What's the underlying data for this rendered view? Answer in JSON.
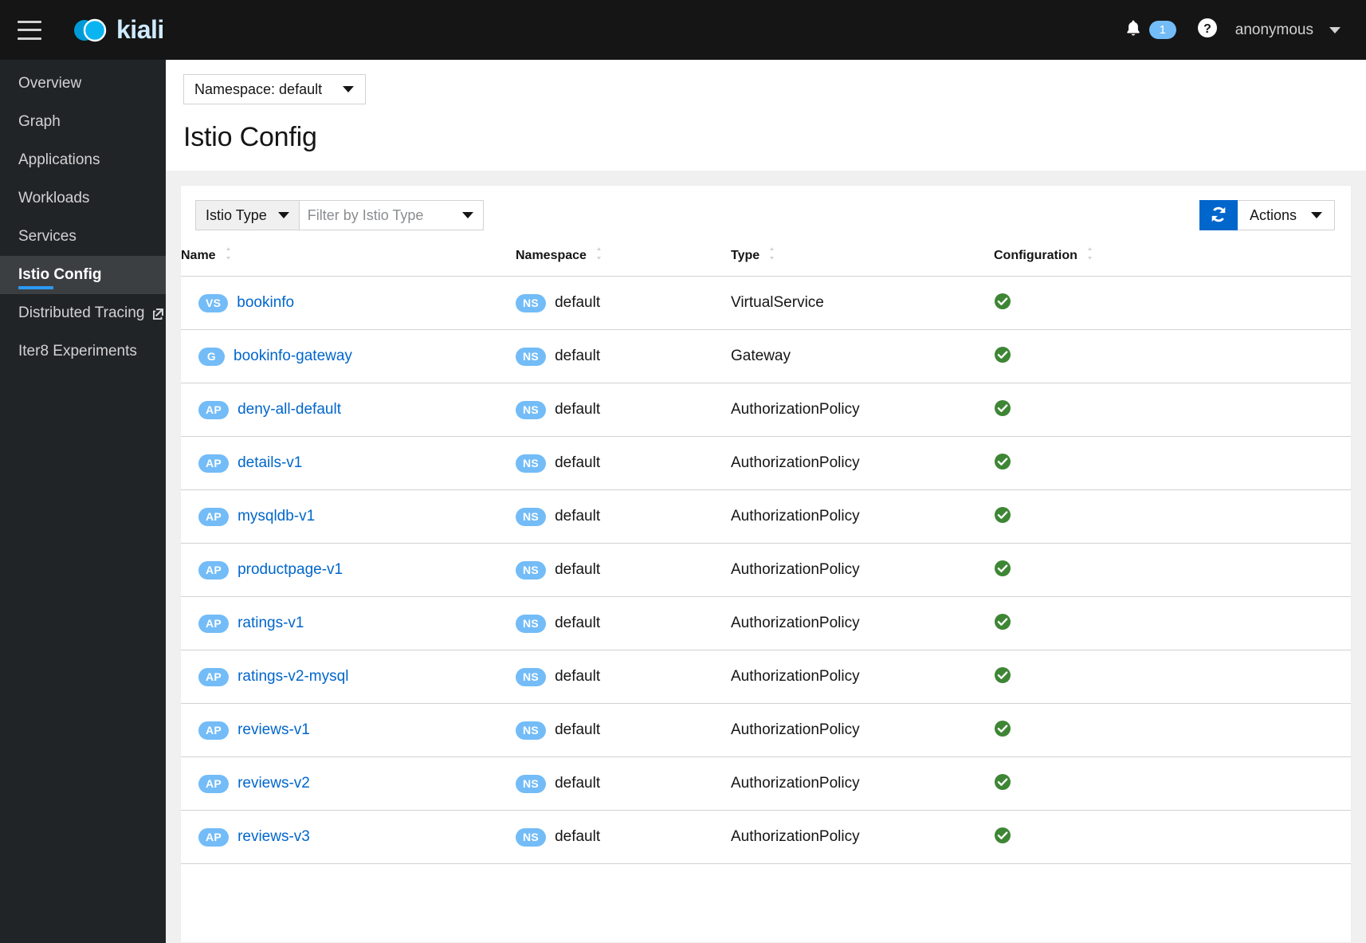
{
  "masthead": {
    "menu_icon": "hamburger-icon",
    "brand_name": "kiali",
    "notifications": {
      "icon": "bell-icon",
      "count": "1"
    },
    "help_icon": "question-circle-icon",
    "user": "anonymous",
    "user_caret_icon": "caret-down-icon"
  },
  "sidebar": {
    "items": [
      {
        "label": "Overview",
        "active": false,
        "external": false
      },
      {
        "label": "Graph",
        "active": false,
        "external": false
      },
      {
        "label": "Applications",
        "active": false,
        "external": false
      },
      {
        "label": "Workloads",
        "active": false,
        "external": false
      },
      {
        "label": "Services",
        "active": false,
        "external": false
      },
      {
        "label": "Istio Config",
        "active": true,
        "external": false
      },
      {
        "label": "Distributed Tracing",
        "active": false,
        "external": true
      },
      {
        "label": "Iter8 Experiments",
        "active": false,
        "external": false
      }
    ]
  },
  "page": {
    "namespace_selector": "Namespace: default",
    "title": "Istio Config"
  },
  "toolbar": {
    "filter_type_label": "Istio Type",
    "filter_placeholder": "Filter by Istio Type",
    "filter_value": "",
    "refresh_icon": "refresh-sync-icon",
    "actions_label": "Actions"
  },
  "table": {
    "columns": [
      {
        "label": "Name",
        "sort_icon": "sort-arrows-icon"
      },
      {
        "label": "Namespace",
        "sort_icon": "sort-arrows-icon"
      },
      {
        "label": "Type",
        "sort_icon": "sort-arrows-icon"
      },
      {
        "label": "Configuration",
        "sort_icon": "sort-arrows-icon"
      }
    ],
    "rows": [
      {
        "badge": "VS",
        "name": "bookinfo",
        "ns_badge": "NS",
        "namespace": "default",
        "type": "VirtualService",
        "config_icon": "check-circle-icon"
      },
      {
        "badge": "G",
        "name": "bookinfo-gateway",
        "ns_badge": "NS",
        "namespace": "default",
        "type": "Gateway",
        "config_icon": "check-circle-icon"
      },
      {
        "badge": "AP",
        "name": "deny-all-default",
        "ns_badge": "NS",
        "namespace": "default",
        "type": "AuthorizationPolicy",
        "config_icon": "check-circle-icon"
      },
      {
        "badge": "AP",
        "name": "details-v1",
        "ns_badge": "NS",
        "namespace": "default",
        "type": "AuthorizationPolicy",
        "config_icon": "check-circle-icon"
      },
      {
        "badge": "AP",
        "name": "mysqldb-v1",
        "ns_badge": "NS",
        "namespace": "default",
        "type": "AuthorizationPolicy",
        "config_icon": "check-circle-icon"
      },
      {
        "badge": "AP",
        "name": "productpage-v1",
        "ns_badge": "NS",
        "namespace": "default",
        "type": "AuthorizationPolicy",
        "config_icon": "check-circle-icon"
      },
      {
        "badge": "AP",
        "name": "ratings-v1",
        "ns_badge": "NS",
        "namespace": "default",
        "type": "AuthorizationPolicy",
        "config_icon": "check-circle-icon"
      },
      {
        "badge": "AP",
        "name": "ratings-v2-mysql",
        "ns_badge": "NS",
        "namespace": "default",
        "type": "AuthorizationPolicy",
        "config_icon": "check-circle-icon"
      },
      {
        "badge": "AP",
        "name": "reviews-v1",
        "ns_badge": "NS",
        "namespace": "default",
        "type": "AuthorizationPolicy",
        "config_icon": "check-circle-icon"
      },
      {
        "badge": "AP",
        "name": "reviews-v2",
        "ns_badge": "NS",
        "namespace": "default",
        "type": "AuthorizationPolicy",
        "config_icon": "check-circle-icon"
      },
      {
        "badge": "AP",
        "name": "reviews-v3",
        "ns_badge": "NS",
        "namespace": "default",
        "type": "AuthorizationPolicy",
        "config_icon": "check-circle-icon"
      }
    ]
  },
  "colors": {
    "masthead_bg": "#151515",
    "sidebar_bg": "#212427",
    "accent_blue": "#2b9af3",
    "link_blue": "#0066cc",
    "badge_blue": "#73bcf7",
    "status_green": "#3e8635"
  }
}
